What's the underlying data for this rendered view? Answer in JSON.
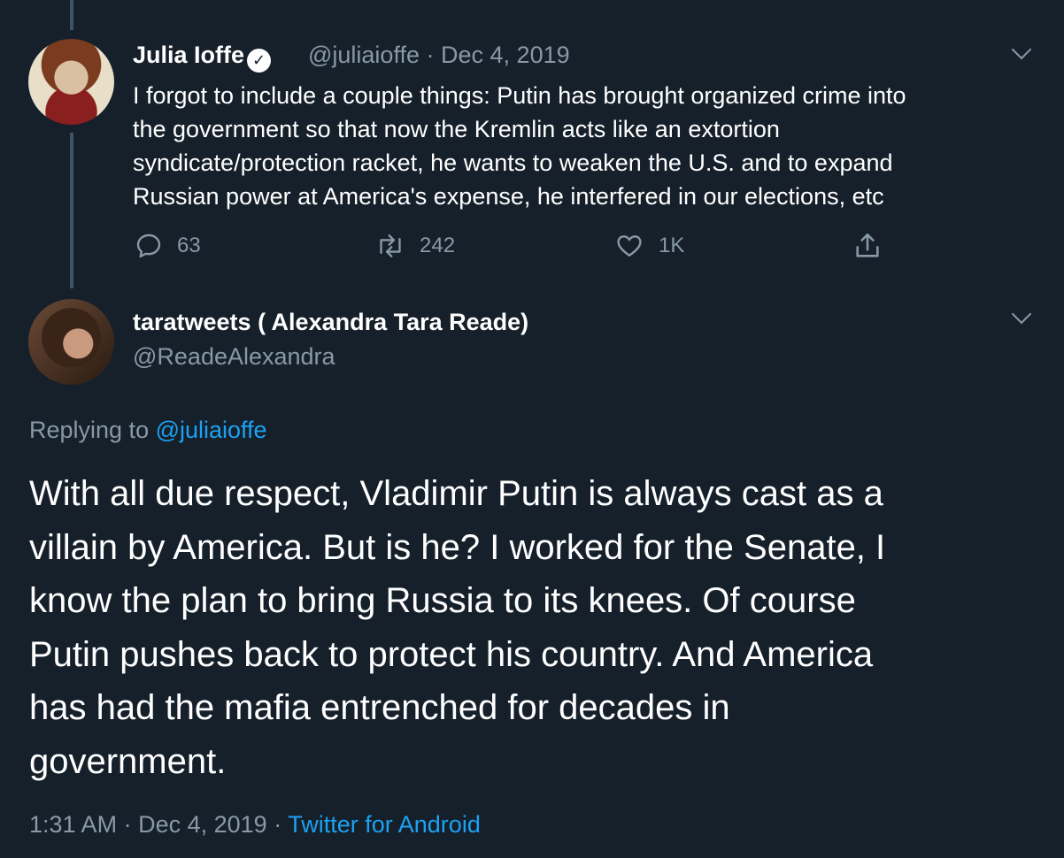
{
  "tweet1": {
    "name": "Julia Ioffe",
    "handle": "@juliaioffe",
    "separator": "·",
    "date": "Dec 4, 2019",
    "text_lines": [
      "I forgot to include a couple things: Putin has brought organized crime into",
      "the government so that now the Kremlin acts like an extortion",
      "syndicate/protection racket, he wants to weaken the U.S. and to expand",
      "Russian power at America's expense, he interfered in our elections, etc"
    ],
    "replies": "63",
    "retweets": "242",
    "likes": "1K"
  },
  "tweet2": {
    "name": "taratweets ( Alexandra Tara Reade)",
    "handle": "@ReadeAlexandra",
    "replying_prefix": "Replying to ",
    "replying_handle": "@juliaioffe",
    "text_lines": [
      "With all due respect, Vladimir Putin is always cast as a",
      "villain by America. But is he? I worked for the Senate, I",
      "know the plan to bring Russia to its knees. Of course",
      "Putin pushes back to protect his country. And America",
      "has had the mafia entrenched for decades in",
      "government."
    ],
    "time": "1:31 AM",
    "date": "Dec 4, 2019",
    "separator": "·",
    "source": "Twitter for Android"
  },
  "colors": {
    "background": "#15202b",
    "text": "#ffffff",
    "muted": "#8899a6",
    "link": "#1da1f2",
    "thread_line": "#3d5466"
  }
}
